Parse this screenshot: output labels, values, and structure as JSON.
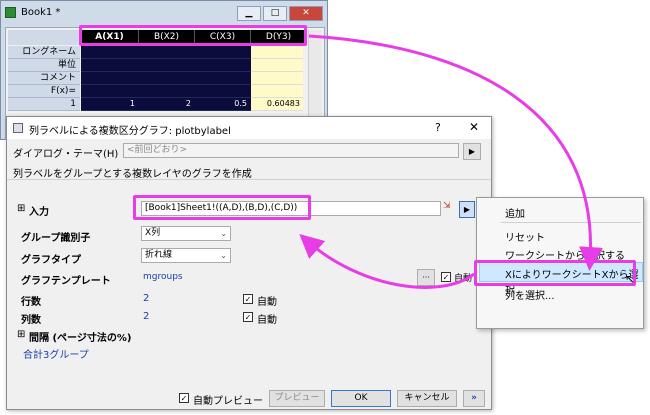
{
  "book": {
    "title": "Book1 *",
    "columns": [
      "A(X1)",
      "B(X2)",
      "C(X3)",
      "D(Y3)"
    ],
    "row_labels": [
      "ロングネーム",
      "単位",
      "コメント",
      "F(x)=",
      "1"
    ],
    "row1_values": [
      "1",
      "2",
      "0.5",
      "0.60483"
    ],
    "win_minimize": "▁",
    "win_maximize": "□",
    "win_close": "✕"
  },
  "dialog": {
    "title": "列ラベルによる複数区分グラフ: plotbylabel",
    "help": "?",
    "close": "✕",
    "theme_label": "ダイアログ・テーマ(H)",
    "theme_value": "<前回どおり>",
    "description": "列ラベルをグループとする複数レイヤのグラフを作成",
    "input_label": "入力",
    "input_value": "[Book1]Sheet1!((A,D),(B,D),(C,D))",
    "group_label": "グループ識別子",
    "group_value": "X列",
    "graphtype_label": "グラフタイプ",
    "graphtype_value": "折れ線",
    "template_label": "グラフテンプレート",
    "template_value": "mgroups",
    "rows_label": "行数",
    "rows_value": "2",
    "cols_label": "列数",
    "cols_value": "2",
    "auto_label": "自動",
    "gap_label": "間隔 (ページ寸法の%)",
    "total_groups": "合計3グループ",
    "auto_preview": "自動プレビュー",
    "preview_btn": "プレビュー",
    "ok_btn": "OK",
    "cancel_btn": "キャンセル",
    "more_btn": "»",
    "expand_plus": "⊞",
    "tree_plus": "⊞",
    "dots_btn": "···"
  },
  "menu": {
    "items": [
      "追加",
      "リセット",
      "ワークシートから選択する",
      "XによりワークシートXから選択",
      "列を選択..."
    ]
  },
  "colors": {
    "highlight": "#e83ce6",
    "sheet_data": "#0c0c3c",
    "link_blue": "#1a3fa8"
  }
}
